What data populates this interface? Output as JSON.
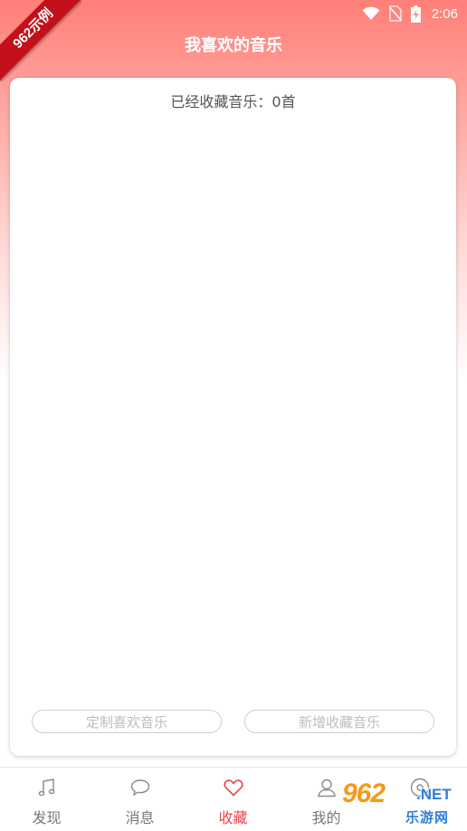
{
  "status_bar": {
    "time": "2:06",
    "icons": [
      "wifi-icon",
      "no-sim-icon",
      "battery-charging-icon"
    ]
  },
  "ribbon": {
    "text": "962示例"
  },
  "header": {
    "title": "我喜欢的音乐"
  },
  "card": {
    "count_text": "已经收藏音乐：0首",
    "buttons": {
      "customize_label": "定制喜欢音乐",
      "add_label": "新增收藏音乐"
    }
  },
  "tabs": [
    {
      "label": "发现",
      "icon": "music-note-icon",
      "active": false
    },
    {
      "label": "消息",
      "icon": "chat-bubble-icon",
      "active": false
    },
    {
      "label": "收藏",
      "icon": "heart-icon",
      "active": true
    },
    {
      "label": "我的",
      "icon": "user-icon",
      "active": false
    },
    {
      "label": "",
      "icon": "disc-icon",
      "active": false
    }
  ],
  "watermark": {
    "main": "962",
    "net": ".NET",
    "sub": "乐游网"
  },
  "colors": {
    "header_gradient_top": "#ff7e78",
    "accent_active": "#e8434a",
    "ribbon": "#c4101a",
    "inactive_text": "#777777"
  }
}
